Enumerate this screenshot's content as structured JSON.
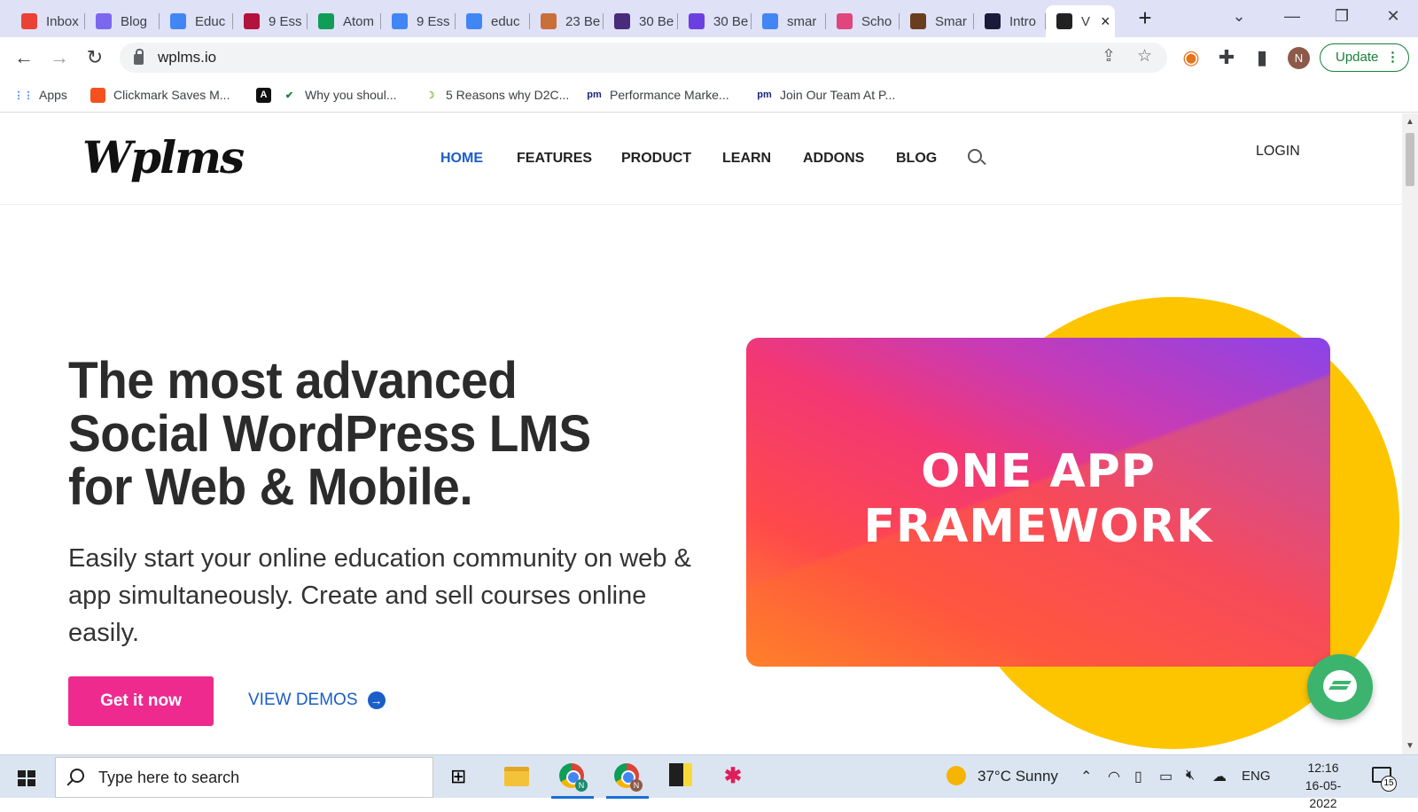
{
  "browser": {
    "tabs": [
      {
        "title": "Inbox",
        "icon": "gmail-icon",
        "color": "#ea4335"
      },
      {
        "title": "Blog",
        "icon": "clickup-icon",
        "color": "#7b68ee"
      },
      {
        "title": "Educ",
        "icon": "google-docs-icon",
        "color": "#4285f4"
      },
      {
        "title": "9 Ess",
        "icon": "atom-app-icon",
        "color": "#b3123c"
      },
      {
        "title": "Atom",
        "icon": "google-drive-icon",
        "color": "#0f9d58"
      },
      {
        "title": "9 Ess",
        "icon": "google-icon",
        "color": "#4285f4"
      },
      {
        "title": "educ",
        "icon": "google-icon",
        "color": "#4285f4"
      },
      {
        "title": "23 Be",
        "icon": "mascot-icon",
        "color": "#c86f3a"
      },
      {
        "title": "30 Be",
        "icon": "colorlib-icon",
        "color": "#4a2a7a"
      },
      {
        "title": "30 Be",
        "icon": "astra-icon",
        "color": "#6c3fe0"
      },
      {
        "title": "smar",
        "icon": "google-icon",
        "color": "#4285f4"
      },
      {
        "title": "Scho",
        "icon": "flower-icon",
        "color": "#e0457b"
      },
      {
        "title": "Smar",
        "icon": "book-thumbnail-icon",
        "color": "#6a3d1f"
      },
      {
        "title": "Intro",
        "icon": "dark-app-icon",
        "color": "#1a1a3a"
      },
      {
        "title": "V",
        "icon": "wplms-icon",
        "color": "#222222"
      }
    ],
    "url": "wplms.io",
    "update_label": "Update",
    "avatar_initial": "N",
    "bookmarks": [
      {
        "label": "Apps",
        "icon": "apps-grid-icon"
      },
      {
        "label": "Clickmark Saves M...",
        "icon": "clickmark-icon"
      },
      {
        "label": "",
        "icon": "a-letter-icon"
      },
      {
        "label": "Why you shoul...",
        "icon": "checkmark-icon"
      },
      {
        "label": "5 Reasons why D2C...",
        "icon": "crescent-icon"
      },
      {
        "label": "Performance Marke...",
        "icon": "pm-logo-icon"
      },
      {
        "label": "Join Our Team At P...",
        "icon": "pm-logo-icon"
      }
    ]
  },
  "site": {
    "logo": "Wplms",
    "nav": [
      "HOME",
      "FEATURES",
      "PRODUCT",
      "LEARN",
      "ADDONS",
      "BLOG"
    ],
    "login": "LOGIN",
    "hero_title": "The most advanced Social WordPress LMS for Web & Mobile.",
    "hero_subtitle": "Easily start your online education community on web & app simultaneously. Create and sell courses online easily.",
    "cta_primary": "Get it now",
    "cta_secondary": "VIEW DEMOS",
    "promo_line1": "ONE APP",
    "promo_line2": "FRAMEWORK",
    "colors": {
      "accent": "#ee2a8f",
      "link": "#1a5ec8",
      "circle": "#fdc500",
      "messenger": "#3cb46e"
    }
  },
  "taskbar": {
    "search_placeholder": "Type here to search",
    "weather": "37°C  Sunny",
    "language": "ENG",
    "time": "12:16",
    "date": "16-05-2022",
    "notification_count": "15"
  }
}
